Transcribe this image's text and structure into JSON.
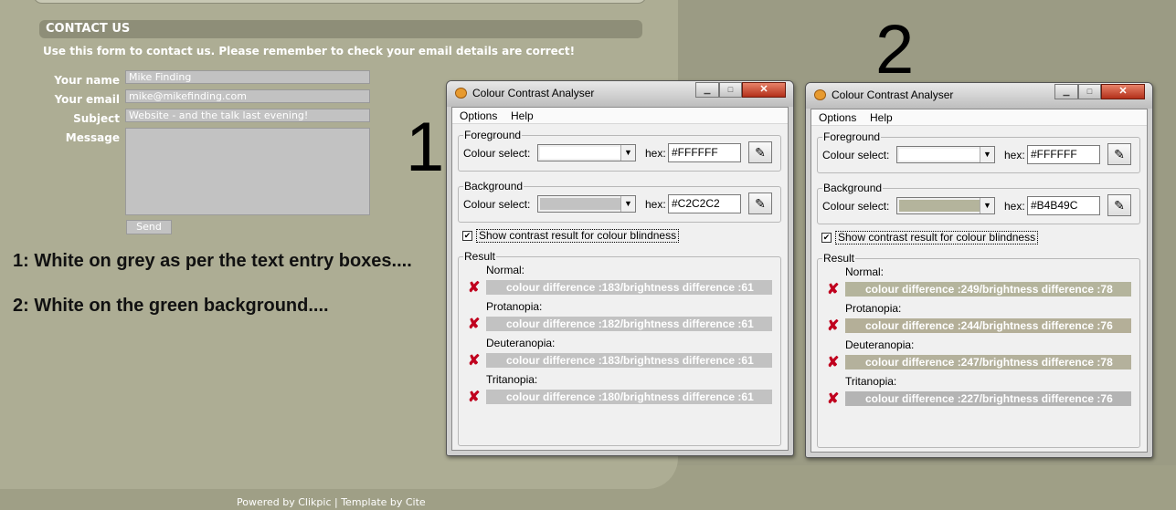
{
  "colors": {
    "green_bg": "#B4B49C",
    "grey": "#C2C2C2",
    "white": "#FFFFFF",
    "fail": "#C0001E"
  },
  "contact": {
    "header": "CONTACT US",
    "intro": "Use this form to contact us. Please remember to check your email details are correct!",
    "name_label": "Your name",
    "name_value": "Mike Finding",
    "email_label": "Your email",
    "email_value": "mike@mikefinding.com",
    "subject_label": "Subject",
    "subject_value": "Website - and the talk last evening!",
    "message_label": "Message",
    "send_label": "Send"
  },
  "notes": {
    "line1": "1: White on grey as per the text entry boxes....",
    "line2": "2: White on the green background...."
  },
  "markers": {
    "one": "1",
    "two": "2"
  },
  "footer": "Powered by Clikpic | Template by Cite",
  "analysers": [
    {
      "title": "Colour Contrast Analyser",
      "menu": [
        "Options",
        "Help"
      ],
      "fg_legend": "Foreground",
      "fg_select_label": "Colour select:",
      "fg_hex_label": "hex:",
      "fg_hex": "#FFFFFF",
      "bg_legend": "Background",
      "bg_select_label": "Colour select:",
      "bg_hex_label": "hex:",
      "bg_hex": "#C2C2C2",
      "checkbox_label": "Show contrast result for colour blindness",
      "result_legend": "Result",
      "results": [
        {
          "name": "Normal:",
          "text": "colour difference :183/brightness difference :61"
        },
        {
          "name": "Protanopia:",
          "text": "colour difference :182/brightness difference :61"
        },
        {
          "name": "Deuteranopia:",
          "text": "colour difference :183/brightness difference :61"
        },
        {
          "name": "Tritanopia:",
          "text": "colour difference :180/brightness difference :61"
        }
      ]
    },
    {
      "title": "Colour Contrast Analyser",
      "menu": [
        "Options",
        "Help"
      ],
      "fg_legend": "Foreground",
      "fg_select_label": "Colour select:",
      "fg_hex_label": "hex:",
      "fg_hex": "#FFFFFF",
      "bg_legend": "Background",
      "bg_select_label": "Colour select:",
      "bg_hex_label": "hex:",
      "bg_hex": "#B4B49C",
      "checkbox_label": "Show contrast result for colour blindness",
      "result_legend": "Result",
      "results": [
        {
          "name": "Normal:",
          "text": "colour difference :249/brightness difference :78"
        },
        {
          "name": "Protanopia:",
          "text": "colour difference :244/brightness difference :76"
        },
        {
          "name": "Deuteranopia:",
          "text": "colour difference :247/brightness difference :78"
        },
        {
          "name": "Tritanopia:",
          "text": "colour difference :227/brightness difference :76"
        }
      ]
    }
  ],
  "result_bar_colors": [
    [
      "#C2C2C2",
      "#C2C2C2",
      "#C2C2C2",
      "#C2C2C2"
    ],
    [
      "#B4B49C",
      "#B4AF98",
      "#B4B19C",
      "#B4B4B4"
    ]
  ]
}
